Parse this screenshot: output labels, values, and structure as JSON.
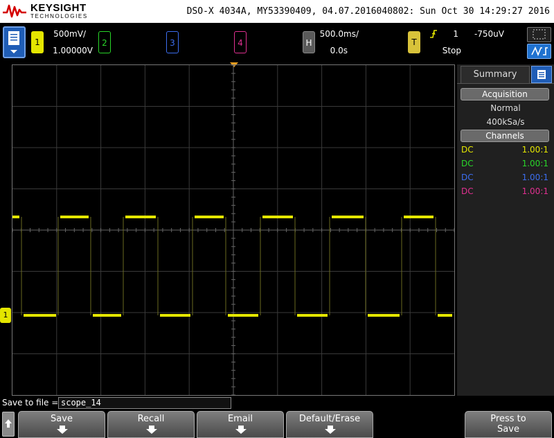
{
  "brand": {
    "name": "KEYSIGHT",
    "sub": "TECHNOLOGIES"
  },
  "scope_info": "DSO-X 4034A, MY53390409, 04.07.2016040802: Sun Oct 30 14:29:27 2016",
  "channels": [
    {
      "num": "1",
      "scale": "500mV/",
      "offset": "1.00000V",
      "color": "#e4e600"
    },
    {
      "num": "2",
      "color": "#29d629"
    },
    {
      "num": "3",
      "color": "#3c6ef0"
    },
    {
      "num": "4",
      "color": "#e03090"
    }
  ],
  "horizontal": {
    "label": "H",
    "timebase": "500.0ms/",
    "delay": "0.0s"
  },
  "trigger": {
    "label": "T",
    "source": "1",
    "level": "-750uV",
    "status": "Stop",
    "edge_icon": "rising-edge-icon"
  },
  "ch1_marker": "1",
  "side_panel": {
    "tab": "Summary",
    "acquisition_header": "Acquisition",
    "mode": "Normal",
    "rate": "400kSa/s",
    "channels_header": "Channels",
    "channel_rows": [
      {
        "coupling": "DC",
        "ratio": "1.00:1",
        "color": "#e4e600"
      },
      {
        "coupling": "DC",
        "ratio": "1.00:1",
        "color": "#29d629"
      },
      {
        "coupling": "DC",
        "ratio": "1.00:1",
        "color": "#3c6ef0"
      },
      {
        "coupling": "DC",
        "ratio": "1.00:1",
        "color": "#e03090"
      }
    ]
  },
  "save": {
    "label": "Save to file =",
    "filename": "scope_14"
  },
  "softkeys": {
    "save": "Save",
    "recall": "Recall",
    "email": "Email",
    "default_erase": "Default/Erase",
    "press_to": "Press to",
    "press_save": "Save"
  },
  "waveform": {
    "channel": "1",
    "levels": [
      "high",
      "low"
    ],
    "segments": [
      "high",
      "low",
      "high",
      "low",
      "high",
      "low",
      "high",
      "low",
      "high",
      "low",
      "high",
      "low",
      "high",
      "low"
    ]
  }
}
